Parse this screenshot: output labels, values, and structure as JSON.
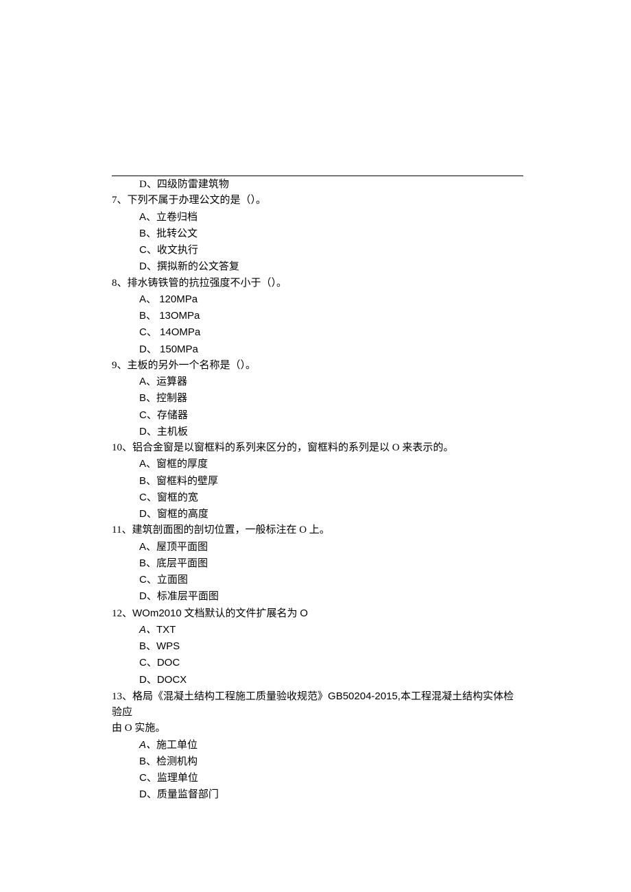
{
  "orphan_option": "D、四级防雷建筑物",
  "questions": [
    {
      "num": "7、",
      "stem": "下列不属于办理公文的是（）。",
      "options": [
        {
          "label": "A、",
          "text": "立卷归档"
        },
        {
          "label": "B、",
          "text": "批转公文"
        },
        {
          "label": "C、",
          "text": "收文执行"
        },
        {
          "label": "D、",
          "text": "撰拟新的公文答复"
        }
      ]
    },
    {
      "num": "8、",
      "stem": "排水铸铁管的抗拉强度不小于（）。",
      "options": [
        {
          "label": "A、 ",
          "text": "120MPa",
          "textArial": true
        },
        {
          "label": "B、 ",
          "text": "13OMPa",
          "textArial": true
        },
        {
          "label": "C、 ",
          "text": "14OMPa",
          "textArial": true
        },
        {
          "label": "D、 ",
          "text": "150MPa",
          "textArial": true
        }
      ]
    },
    {
      "num": "9、",
      "stem": "主板的另外一个名称是（）。",
      "options": [
        {
          "label": "A、",
          "text": "运算器"
        },
        {
          "label": "B、",
          "text": "控制器"
        },
        {
          "label": "C、",
          "text": "存储器"
        },
        {
          "label": "D、",
          "text": "主机板"
        }
      ]
    },
    {
      "num": "10、",
      "stem": "铝合金窗是以窗框料的系列来区分的，窗框料的系列是以 O 来表示的。",
      "options": [
        {
          "label": "A、",
          "text": "窗框的厚度"
        },
        {
          "label": "B、",
          "text": "窗框料的壁厚"
        },
        {
          "label": "C、",
          "text": "窗框的宽"
        },
        {
          "label": "D、",
          "text": "窗框的高度"
        }
      ]
    },
    {
      "num": "11、",
      "stem": "建筑剖面图的剖切位置，一般标注在 O 上。",
      "options": [
        {
          "label": "A、",
          "text": "屋顶平面图"
        },
        {
          "label": "B、",
          "text": "底层平面图"
        },
        {
          "label": "C、",
          "text": "立面图"
        },
        {
          "label": "D、",
          "text": "标准层平面图"
        }
      ]
    },
    {
      "num": "12、",
      "stem_parts": [
        "WOm2010",
        " 文档默认的文件扩展名为 ",
        "O"
      ],
      "options": [
        {
          "label": "A、",
          "labelItalic": true,
          "text": "TXT",
          "textArial": true
        },
        {
          "label": "B、",
          "text": "WPS",
          "textArial": true
        },
        {
          "label": "C、",
          "text": "DOC",
          "textArial": true
        },
        {
          "label": "D、",
          "text": "DOCX",
          "textArial": true
        }
      ]
    },
    {
      "num": "13、",
      "stem_parts_mixed": [
        {
          "t": "格局《混凝土结构工程施工质量验收规范》"
        },
        {
          "t": "GB50204-2015,",
          "arial": true
        },
        {
          "t": "本工程混凝土结构实体检验应"
        }
      ],
      "stem_line2": "由 O 实施。",
      "options": [
        {
          "label": "A、",
          "labelItalic": true,
          "text": "施工单位"
        },
        {
          "label": "B、",
          "text": "检测机构"
        },
        {
          "label": "C、",
          "text": "监理单位"
        },
        {
          "label": "D、",
          "text": "质量监督部门"
        }
      ]
    }
  ]
}
